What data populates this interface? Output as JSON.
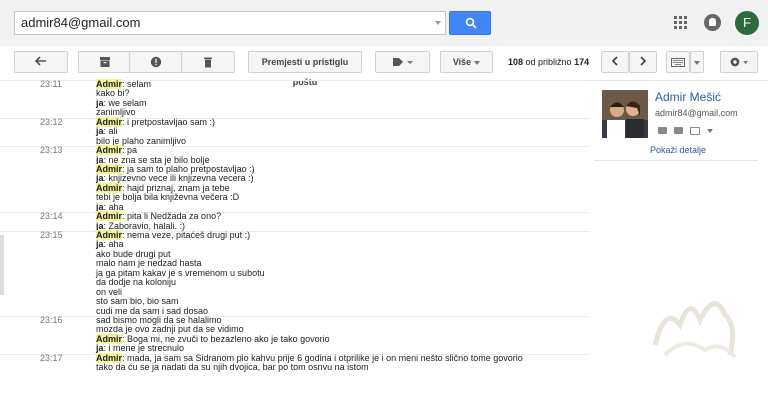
{
  "search": {
    "value": "admir84@gmail.com"
  },
  "user": {
    "avatar_letter": "F"
  },
  "toolbar": {
    "move_to_inbox": "Premjesti u pristiglu poštu",
    "more": "Više",
    "count_from": "108",
    "count_mid": " od približno ",
    "count_total": "174"
  },
  "contact": {
    "name": "Admir Mešić",
    "email": "admir84@gmail.com",
    "details_link": "Pokaži detalje"
  },
  "chat": [
    {
      "time": "23:11",
      "speaker": "Admir",
      "text": ": selam"
    },
    {
      "time": "",
      "speaker": "",
      "text": "kako bi?"
    },
    {
      "time": "",
      "speaker": "ja",
      "text": ": we selam"
    },
    {
      "time": "",
      "speaker": "",
      "text": "zanimljivo"
    },
    {
      "time": "23:12",
      "speaker": "Admir",
      "text": ": i pretpostavljao sam :)"
    },
    {
      "time": "",
      "speaker": "ja",
      "text": ": ali"
    },
    {
      "time": "",
      "speaker": "",
      "text": "bilo je plaho zanimljivo"
    },
    {
      "time": "23:13",
      "speaker": "Admir",
      "text": ": pa"
    },
    {
      "time": "",
      "speaker": "ja",
      "text": ": ne zna se sta je bilo bolje"
    },
    {
      "time": "",
      "speaker": "Admir",
      "text": ": ja sam to plaho pretpostavljao :)"
    },
    {
      "time": "",
      "speaker": "ja",
      "text": ": knjizevno vece ili knjizevna vecera :)"
    },
    {
      "time": "",
      "speaker": "Admir",
      "text": ": hajd priznaj, znam ja tebe"
    },
    {
      "time": "",
      "speaker": "",
      "text": "tebi je bolja bila književna večera :D"
    },
    {
      "time": "",
      "speaker": "ja",
      "text": ": aha"
    },
    {
      "time": "23:14",
      "speaker": "Admir",
      "text": ": pita li Nedžada za ono?"
    },
    {
      "time": "",
      "speaker": "ja",
      "text": ": Zaboravio, halali. :)"
    },
    {
      "time": "23:15",
      "speaker": "Admir",
      "text": ": nema veze, pitaćeš drugi put :)"
    },
    {
      "time": "",
      "speaker": "ja",
      "text": ": aha"
    },
    {
      "time": "",
      "speaker": "",
      "text": "ako bude drugi put"
    },
    {
      "time": "",
      "speaker": "",
      "text": "malo nam je nedzad hasta"
    },
    {
      "time": "",
      "speaker": "",
      "text": "ja ga pitam kakav je s vremenom u subotu"
    },
    {
      "time": "",
      "speaker": "",
      "text": "da dodje na koloniju"
    },
    {
      "time": "",
      "speaker": "",
      "text": "on veli"
    },
    {
      "time": "",
      "speaker": "",
      "text": "sto sam bio, bio sam"
    },
    {
      "time": "",
      "speaker": "",
      "text": "cudi me da sam i sad dosao"
    },
    {
      "time": "23:16",
      "speaker": "",
      "text": "sad bismo mogli da se halalimo"
    },
    {
      "time": "",
      "speaker": "",
      "text": "mozda je ovo zadnji put da se vidimo"
    },
    {
      "time": "",
      "speaker": "Admir",
      "text": ": Boga mi, ne zvuči to bezazleno ako je tako govorio"
    },
    {
      "time": "",
      "speaker": "ja",
      "text": ": i mene je strecnulo"
    },
    {
      "time": "23:17",
      "speaker": "Admir",
      "text": ": mada, ja sam sa Sidranom pio kahvu prije 6 godina i otprilike je i on meni nešto slično tome govorio"
    },
    {
      "time": "",
      "speaker": "",
      "text": "tako da ću se ja nadati da su njih dvojica, bar po tom osnvu na istom"
    }
  ]
}
